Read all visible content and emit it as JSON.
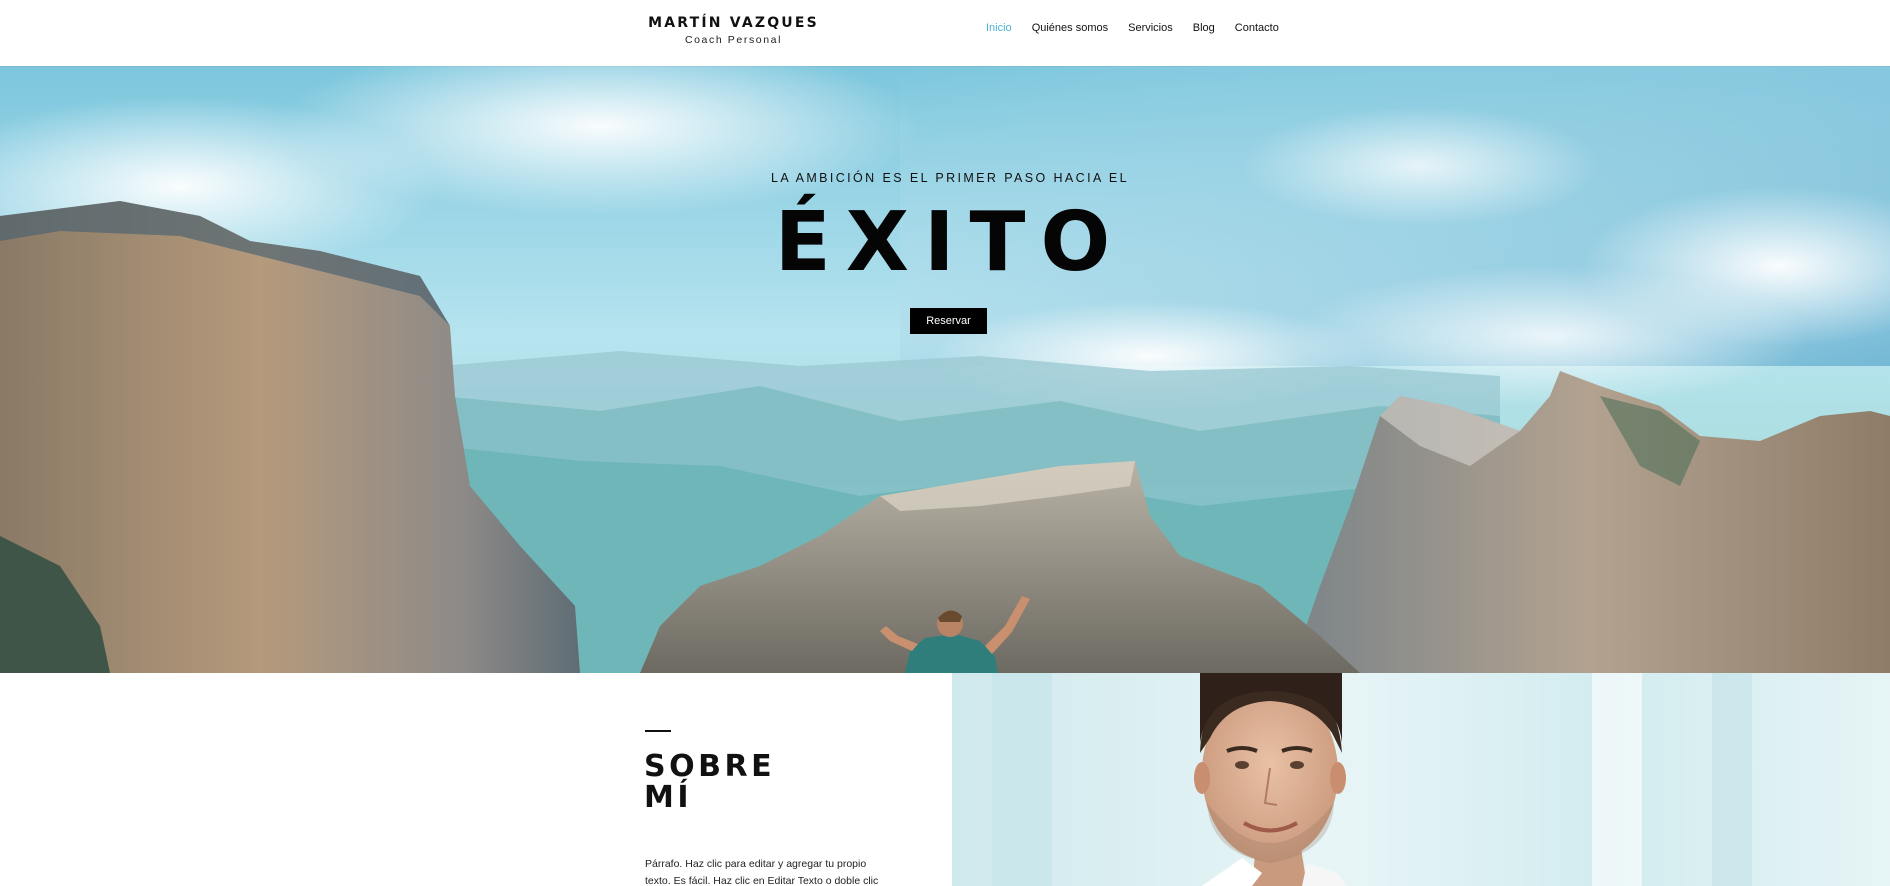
{
  "header": {
    "brand_name": "MARTÍN VAZQUES",
    "brand_subtitle": "Coach Personal",
    "nav": [
      "Inicio",
      "Quiénes somos",
      "Servicios",
      "Blog",
      "Contacto"
    ],
    "active_nav": "Inicio"
  },
  "hero": {
    "kicker": "LA AMBICIÓN ES EL PRIMER PASO HACIA EL",
    "title": "ÉXITO",
    "button_label": "Reservar"
  },
  "about": {
    "title_line1": "SOBRE",
    "title_line2": "MÍ",
    "paragraph": "Párrafo. Haz clic para editar y agregar tu propio texto. Es fácil. Haz clic en Editar Texto o doble clic"
  },
  "colors": {
    "accent": "#4bb3d4",
    "button_bg": "#000000",
    "text": "#111111"
  }
}
